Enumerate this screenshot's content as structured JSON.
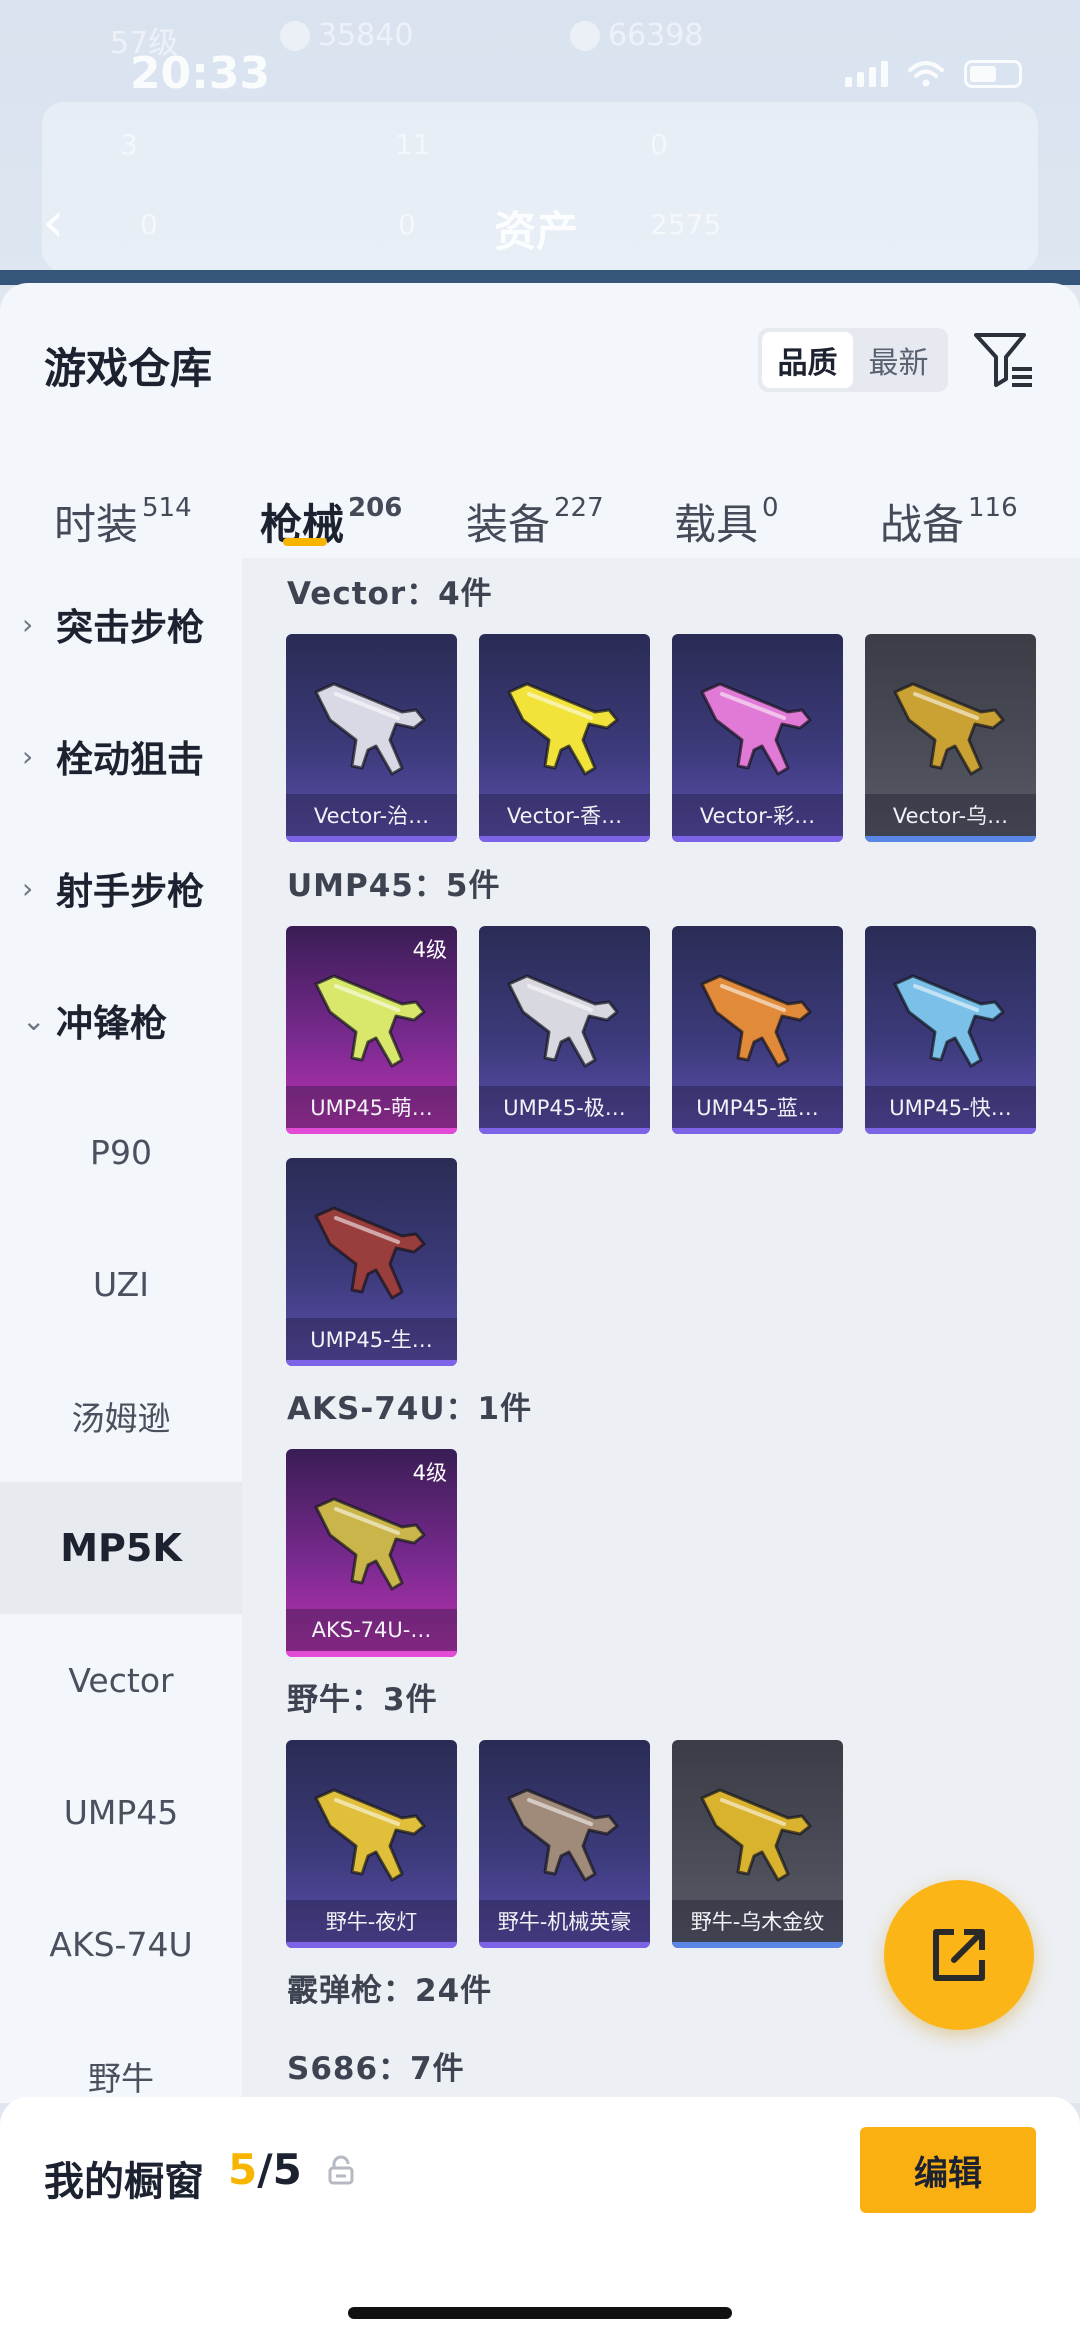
{
  "status_bar": {
    "time": "20:33"
  },
  "background_header": {
    "level": "57级",
    "coins": "35840",
    "points": "66398",
    "page_title": "资产",
    "mini_values": [
      "3",
      "11",
      "0",
      "0",
      "0",
      "2575"
    ]
  },
  "sheet": {
    "title": "游戏仓库",
    "sort_options": [
      {
        "label": "品质",
        "active": true
      },
      {
        "label": "最新",
        "active": false
      }
    ]
  },
  "tabs": [
    {
      "label": "时装",
      "count": "514",
      "active": false
    },
    {
      "label": "枪械",
      "count": "206",
      "active": true
    },
    {
      "label": "装备",
      "count": "227",
      "active": false
    },
    {
      "label": "载具",
      "count": "0",
      "active": false
    },
    {
      "label": "战备",
      "count": "116",
      "active": false
    }
  ],
  "sidebar": {
    "items": [
      {
        "label": "突击步枪",
        "type": "category",
        "chevron": "›"
      },
      {
        "label": "栓动狙击",
        "type": "category",
        "chevron": "›"
      },
      {
        "label": "射手步枪",
        "type": "category",
        "chevron": "›"
      },
      {
        "label": "冲锋枪",
        "type": "category",
        "chevron": "⌄"
      },
      {
        "label": "P90",
        "type": "sub"
      },
      {
        "label": "UZI",
        "type": "sub"
      },
      {
        "label": "汤姆逊",
        "type": "sub"
      },
      {
        "label": "MP5K",
        "type": "sub",
        "selected": true
      },
      {
        "label": "Vector",
        "type": "sub"
      },
      {
        "label": "UMP45",
        "type": "sub"
      },
      {
        "label": "AKS-74U",
        "type": "sub"
      },
      {
        "label": "野牛",
        "type": "sub"
      }
    ]
  },
  "groups": [
    {
      "title": "Vector：4件",
      "items": [
        {
          "label": "Vector-治…",
          "style": "purple",
          "gun_color": "#d9d9e6"
        },
        {
          "label": "Vector-香…",
          "style": "purple",
          "gun_color": "#f2e33a"
        },
        {
          "label": "Vector-彩…",
          "style": "purple",
          "gun_color": "#e07ad6"
        },
        {
          "label": "Vector-乌…",
          "style": "grey",
          "gun_color": "#c9a233"
        }
      ]
    },
    {
      "title": "UMP45：5件",
      "items": [
        {
          "label": "UMP45-萌…",
          "style": "pink",
          "level": "4级",
          "gun_color": "#d9e86a"
        },
        {
          "label": "UMP45-极…",
          "style": "purple",
          "gun_color": "#d8d8e0"
        },
        {
          "label": "UMP45-蓝…",
          "style": "purple",
          "gun_color": "#e08a3a"
        },
        {
          "label": "UMP45-快…",
          "style": "purple",
          "gun_color": "#7ac0e8"
        },
        {
          "label": "UMP45-生…",
          "style": "purple",
          "gun_color": "#9a3d3d"
        }
      ]
    },
    {
      "title": "AKS-74U：1件",
      "items": [
        {
          "label": "AKS-74U-…",
          "style": "pink",
          "level": "4级",
          "gun_color": "#c9b54a"
        }
      ]
    },
    {
      "title": "野牛：3件",
      "items": [
        {
          "label": "野牛-夜灯",
          "style": "purple",
          "gun_color": "#e0c03a"
        },
        {
          "label": "野牛-机械英豪",
          "style": "purple",
          "gun_color": "#a08a7a"
        },
        {
          "label": "野牛-乌木金纹",
          "style": "grey",
          "gun_color": "#d9b22e"
        }
      ]
    },
    {
      "title": "霰弹枪：24件",
      "items": []
    },
    {
      "title": "S686：7件",
      "items": []
    }
  ],
  "showcase": {
    "label": "我的橱窗",
    "current": "5",
    "separator": "/",
    "total": "5",
    "edit_label": "编辑"
  },
  "colors": {
    "accent": "#f7b500",
    "fab": "#fbb517",
    "purple_card_bar": "#7d63e6",
    "pink_card_bar": "#e24bd6",
    "grey_card_bar": "#5a86e6"
  }
}
